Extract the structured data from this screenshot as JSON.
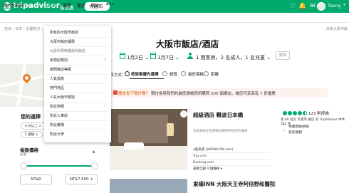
{
  "topbar": {
    "logo": "tripadvisor",
    "logo_sub": "貓途鷹",
    "city": "大阪市",
    "user_name": "Tseng",
    "icons": [
      "heart-icon",
      "notification-icon",
      "inbox-icon",
      "avatar"
    ]
  },
  "nav": {
    "items": [
      "開於大阪市",
      "飯店",
      "機票",
      "優遊",
      "觀光",
      "•••"
    ],
    "active": "飯店"
  },
  "breadcrumb": "亞洲 › 日本 › 近畿地方 › 大阪府 › 大阪市 ›",
  "breadcrumb_right": "日本大阪市飯",
  "page_title": "大阪市飯店/酒店",
  "search": {
    "checkin": "1月2日",
    "checkout": "1月7日",
    "guests": "1 間客房，2 名成人，1 名兒童",
    "update": "更新"
  },
  "filters": {
    "your_choice": "您的選擇",
    "chips_row1": [
      "4 分以上 ×",
      "飯店 ×"
    ],
    "chips_row2": [
      "5 星級 ×",
      "4 星 ×"
    ],
    "price_title": "每晚價格",
    "price_sub": "任意",
    "price_min": "NT$0",
    "price_max": "NT$7,500 +",
    "price_range_fraction": [
      0.0,
      1.0
    ]
  },
  "sortbar": {
    "label": "排序方式：",
    "options": [
      "按旅客優先選擇",
      "超值",
      "最低價格",
      "距離"
    ],
    "active": "按旅客優先選擇"
  },
  "promo": {
    "prefix": "懷念省下預付嗎？",
    "text": "預付會用我們的最低價格資訊購買 200 個網站，讓您可享高有 7 折優惠"
  },
  "hotel1": {
    "name": "超級酒店 難波日本橋",
    "rating_bubbles": 4.5,
    "reviews": "123 則評論",
    "rank": "第 60 名於 大阪市 飯店 的 TripAdvisor 中共 342 名",
    "perks": [
      "免費無線網絡",
      "客房服務"
    ],
    "hint": "這是網站在您選擇日期時所提供的價格",
    "sites": [
      "e路東瀛 (JAPANICAN.com)",
      "Trip.com",
      "Booking.com"
    ],
    "more": "查看全部 4 個價格 ▾"
  },
  "hotel2": {
    "name": "東橫INN 大阪天王寺阿倍野和醫院"
  },
  "dropdown": {
    "items": [
      {
        "label": "所有的大阪市飯店",
        "arrow": false,
        "selected": false
      },
      {
        "label": "大阪市飯店優惠",
        "arrow": false,
        "selected": false
      },
      {
        "label": "大阪市限時優惠的飯店",
        "arrow": false,
        "selected": true
      },
      {
        "label": "依適店類別",
        "arrow": true,
        "selected": false
      },
      {
        "label": "按照飯店等級",
        "arrow": true,
        "selected": false
      },
      {
        "label": "人氣設施",
        "arrow": true,
        "selected": false
      },
      {
        "label": "熱門地區",
        "arrow": true,
        "selected": false
      },
      {
        "label": "人氣大阪市類別",
        "arrow": true,
        "selected": false
      },
      {
        "label": "附近地標",
        "arrow": true,
        "selected": false
      },
      {
        "label": "附近火車站",
        "arrow": true,
        "selected": false
      },
      {
        "label": "附近機場",
        "arrow": true,
        "selected": false
      },
      {
        "label": "附近大學",
        "arrow": true,
        "selected": false
      }
    ]
  }
}
